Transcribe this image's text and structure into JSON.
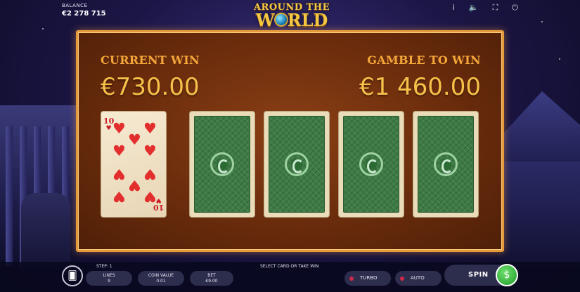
{
  "balance": {
    "label": "BALANCE",
    "value": "€2 278 715"
  },
  "logo": {
    "line1": "AROUND THE",
    "line2_a": "W",
    "line2_b": "RLD"
  },
  "top_icons": [
    "info-icon",
    "sound-icon",
    "fullscreen-icon",
    "power-icon"
  ],
  "top_icon_glyphs": {
    "info": "i",
    "sound": "🔈",
    "fullscreen": "⛶",
    "power": "⏻"
  },
  "board": {
    "current_win_label": "CURRENT WIN",
    "current_win_amount": "€730.00",
    "gamble_label": "GAMBLE TO WIN",
    "gamble_amount": "€1 460.00"
  },
  "revealed_card": {
    "rank": "10",
    "suit": "♥",
    "suit_name": "hearts"
  },
  "face_down_cards": 4,
  "bottom": {
    "step": "STEP: 1",
    "instruction": "SELECT CARD OR TAKE WIN",
    "lines_label": "LINES",
    "lines_value": "9",
    "coin_label": "COIN VALUE",
    "coin_value": "0.01",
    "bet_label": "BET",
    "bet_value": "€9.00",
    "turbo": "TURBO",
    "auto": "AUTO",
    "spin": "SPIN"
  },
  "colors": {
    "board_border": "#e59a3c",
    "win_text": "#f6c04a",
    "label_text": "#f4a63a",
    "card_back": "#3d7a44",
    "spin_icon": "#1f9a2a"
  }
}
